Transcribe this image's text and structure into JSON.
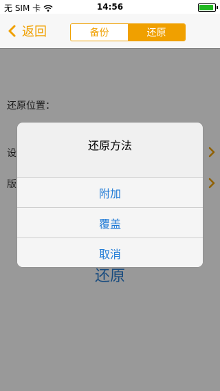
{
  "status_bar": {
    "carrier": "无 SIM 卡",
    "time": "14:56",
    "battery_level": 0.9,
    "wifi_icon": "wifi-icon",
    "battery_icon": "battery-icon"
  },
  "nav": {
    "back_label": "返回",
    "back_icon": "chevron-left-icon",
    "segments": [
      {
        "label": "备份",
        "selected": false
      },
      {
        "label": "还原",
        "selected": true
      }
    ]
  },
  "content": {
    "restore_location_label": "还原位置：",
    "settings_label": "设",
    "version_label": "版",
    "restore_button": "还原"
  },
  "alert": {
    "title": "还原方法",
    "buttons": [
      "附加",
      "覆盖",
      "取消"
    ]
  },
  "colors": {
    "accent": "#f0a000",
    "link": "#1f7ad6",
    "overlay": "rgba(0,0,0,0.40)"
  }
}
